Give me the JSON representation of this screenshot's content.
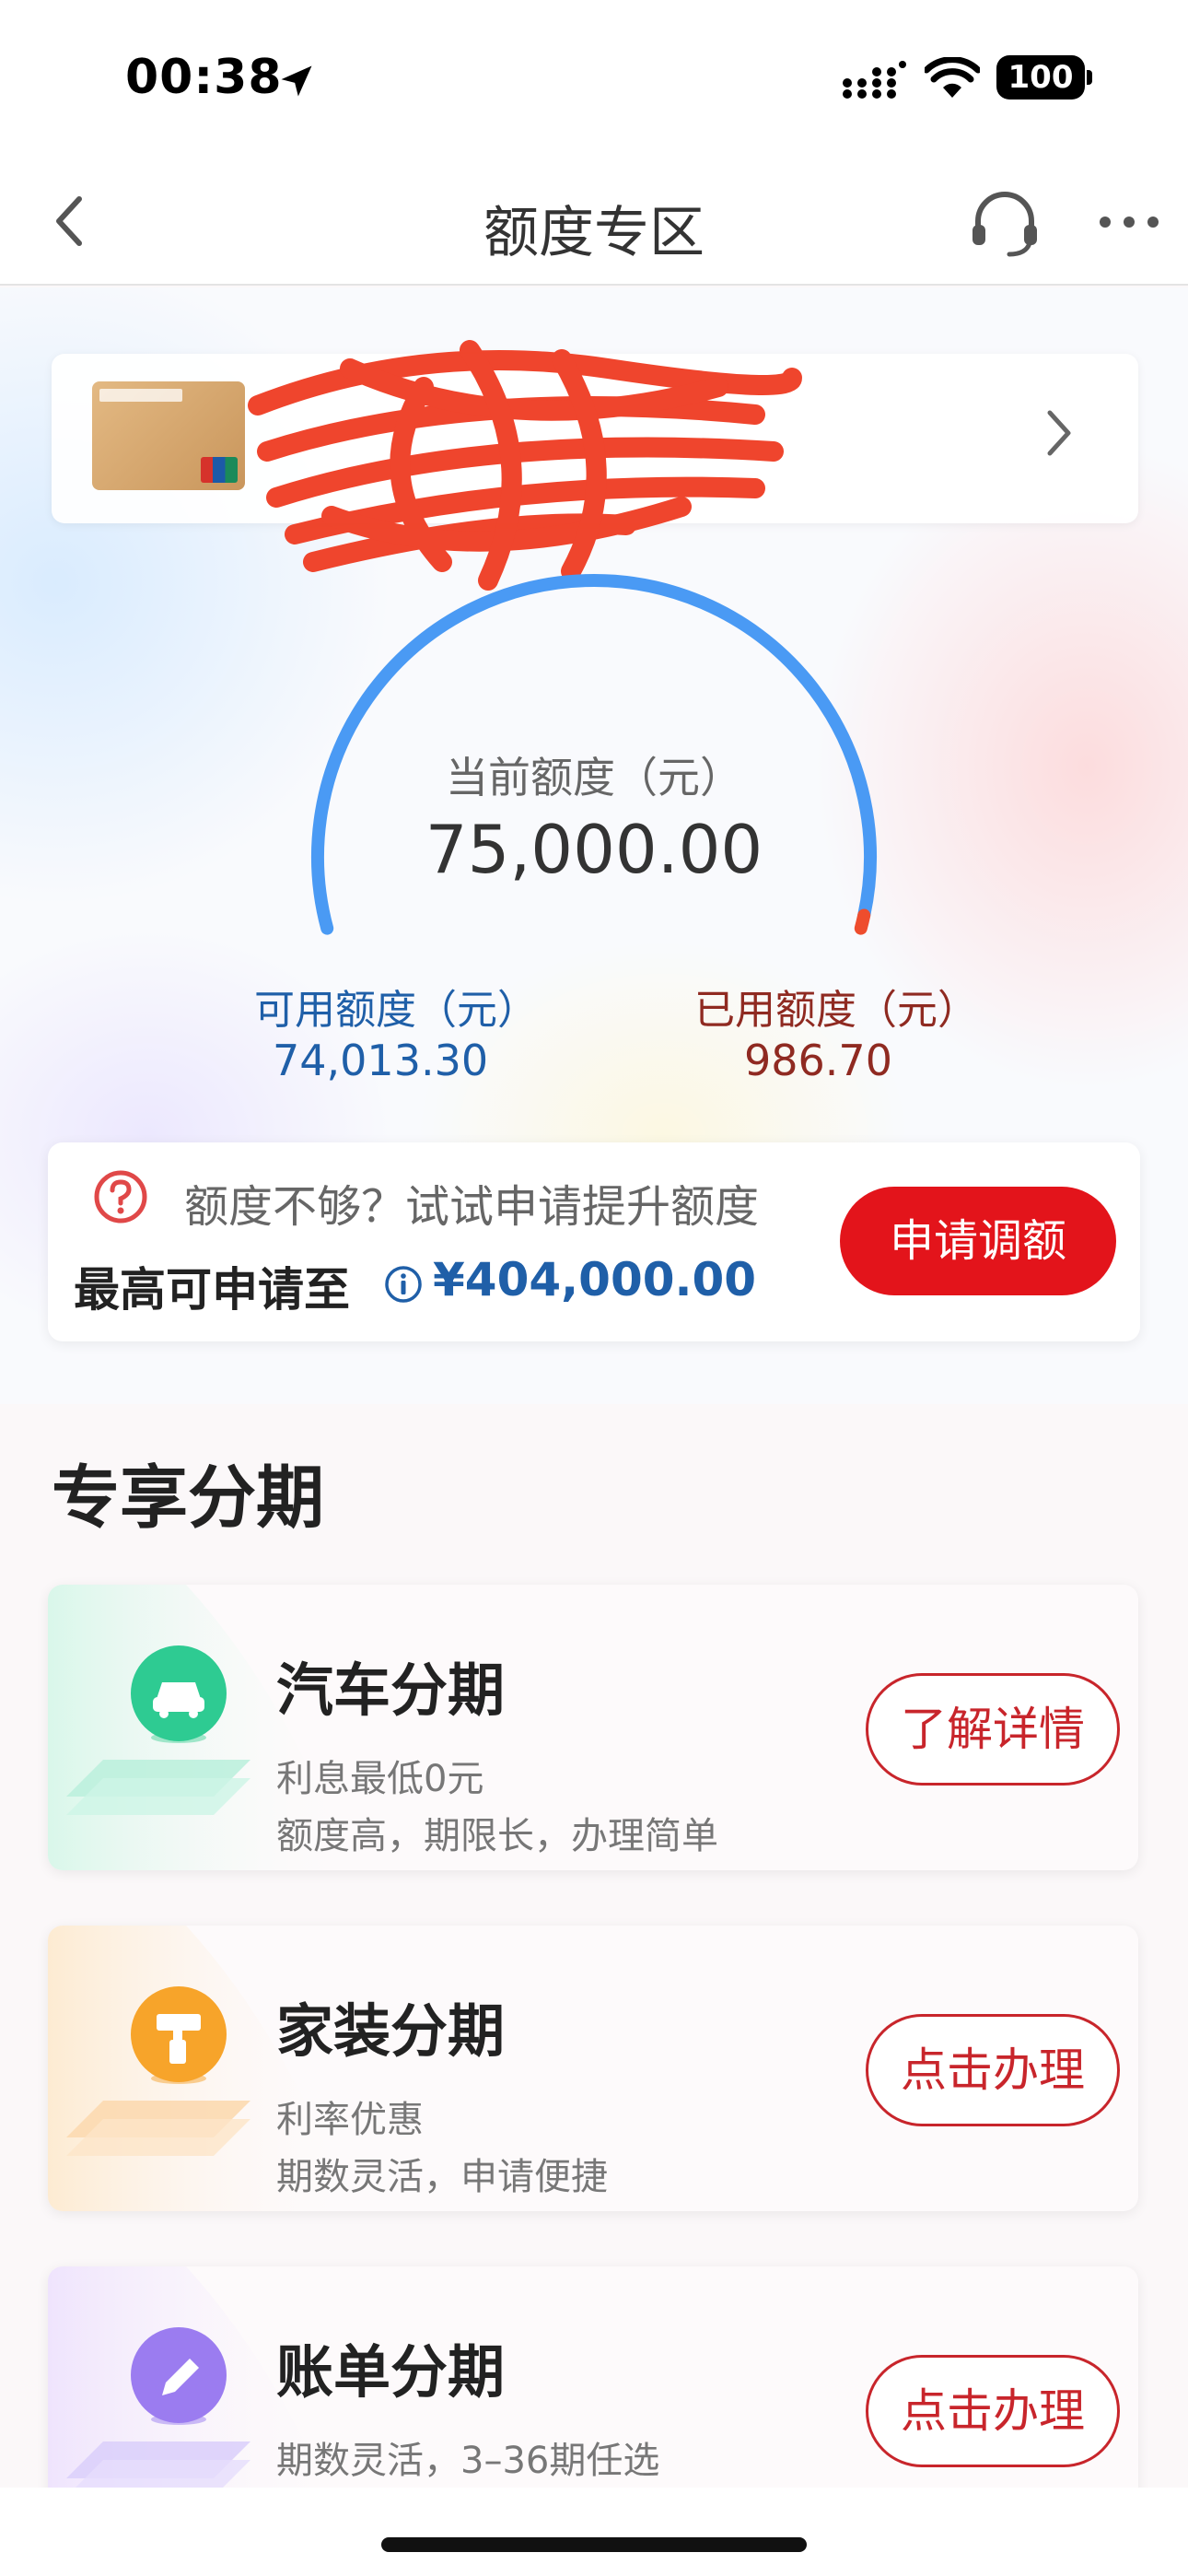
{
  "status_bar": {
    "time": "00:38",
    "battery": "100"
  },
  "nav": {
    "title": "额度专区",
    "icons": [
      "back-arrow-icon",
      "customer-service-icon",
      "more-icon"
    ]
  },
  "limits": {
    "current_label": "当前额度（元）",
    "current_value": "75,000.00",
    "available_label": "可用额度（元）",
    "available_value": "74,013.30",
    "used_label": "已用额度（元）",
    "used_value": "986.70",
    "used_fraction": 0.0132
  },
  "apply": {
    "hint": "额度不够？试试申请提升额度",
    "limit_label": "最高可申请至",
    "limit_value": "¥404,000.00",
    "button_label": "申请调额"
  },
  "section": {
    "title": "专享分期",
    "products": [
      {
        "title": "汽车分期",
        "line1": "利息最低0元",
        "line2": "额度高，期限长，办理简单",
        "button": "了解详情",
        "icon": "car-icon",
        "color": "#2ecb92"
      },
      {
        "title": "家装分期",
        "line1": "利率优惠",
        "line2": "期数灵活，申请便捷",
        "button": "点击办理",
        "icon": "paint-roller-icon",
        "color": "#f7a42a"
      },
      {
        "title": "账单分期",
        "line1": "期数灵活，3–36期任选",
        "line2": "",
        "button": "点击办理",
        "icon": "pencil-icon",
        "color": "#9b7cf0"
      }
    ]
  },
  "colors": {
    "accent_red": "#e3141b",
    "link_blue": "#1f5fa8",
    "gauge_blue": "#4a9af4",
    "used_red": "#8f2a21"
  }
}
